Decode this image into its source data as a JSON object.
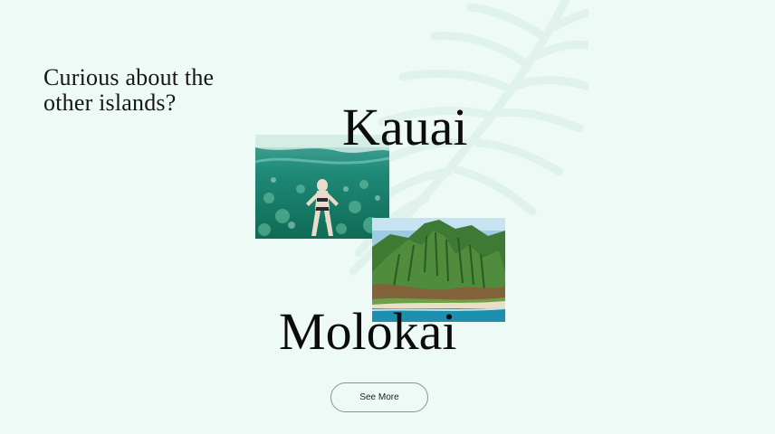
{
  "heading": {
    "line1": "Curious about the",
    "line2": "other islands?"
  },
  "islands": [
    {
      "name": "Kauai",
      "photo_icon": "swimmer-underwater-photo"
    },
    {
      "name": "Molokai",
      "photo_icon": "sea-cliffs-aerial-photo"
    }
  ],
  "cta": {
    "label": "See More"
  },
  "colors": {
    "background": "#eefaf6",
    "text": "#0c0c0c",
    "button_border": "#8a948f"
  }
}
